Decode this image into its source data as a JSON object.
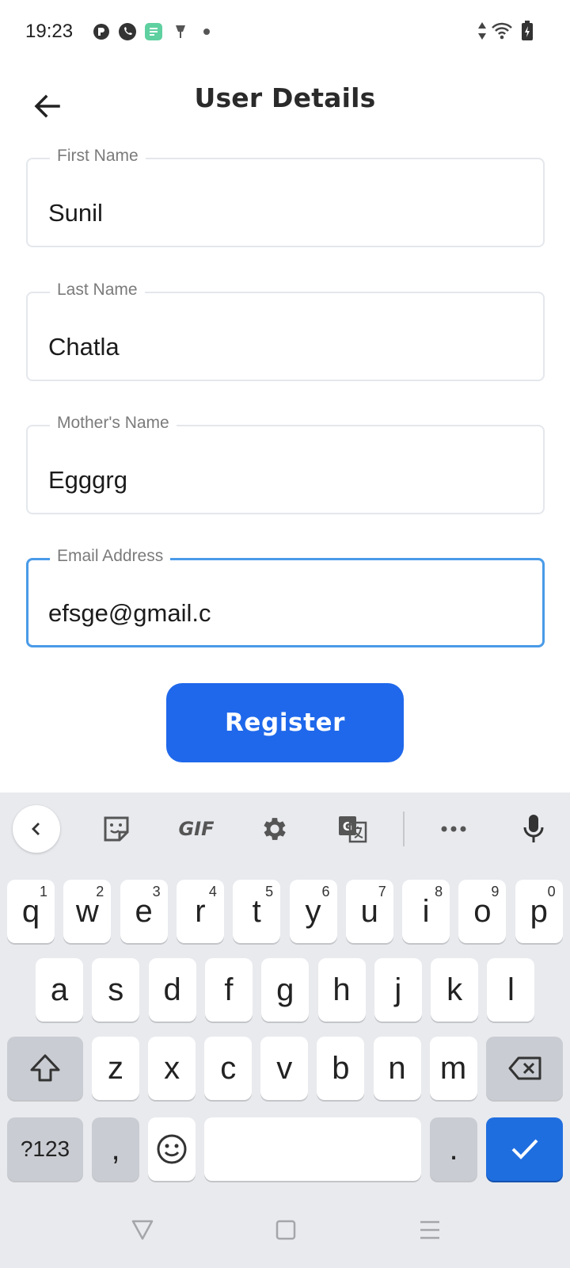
{
  "status_bar": {
    "time": "19:23"
  },
  "header": {
    "title": "User Details"
  },
  "form": {
    "first_name": {
      "label": "First Name",
      "value": "Sunil"
    },
    "last_name": {
      "label": "Last Name",
      "value": "Chatla"
    },
    "mother_name": {
      "label": "Mother's Name",
      "value": "Egggrg"
    },
    "email": {
      "label": "Email Address",
      "value": "efsge@gmail.c"
    },
    "register_label": "Register"
  },
  "keyboard": {
    "toolbar": {
      "gif_label": "GIF"
    },
    "row1": [
      {
        "key": "q",
        "hint": "1"
      },
      {
        "key": "w",
        "hint": "2"
      },
      {
        "key": "e",
        "hint": "3"
      },
      {
        "key": "r",
        "hint": "4"
      },
      {
        "key": "t",
        "hint": "5"
      },
      {
        "key": "y",
        "hint": "6"
      },
      {
        "key": "u",
        "hint": "7"
      },
      {
        "key": "i",
        "hint": "8"
      },
      {
        "key": "o",
        "hint": "9"
      },
      {
        "key": "p",
        "hint": "0"
      }
    ],
    "row2": [
      "a",
      "s",
      "d",
      "f",
      "g",
      "h",
      "j",
      "k",
      "l"
    ],
    "row3": [
      "z",
      "x",
      "c",
      "v",
      "b",
      "n",
      "m"
    ],
    "symbols_label": "?123",
    "comma_label": ",",
    "period_label": "."
  },
  "colors": {
    "accent": "#1f68eb",
    "focus_border": "#4a9be8",
    "keyboard_bg": "#e8eaee",
    "action_key": "#1f6ee0"
  }
}
